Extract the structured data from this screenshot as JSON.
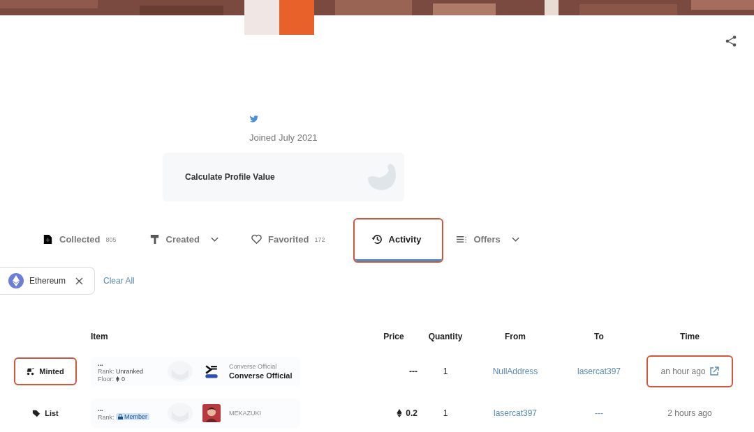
{
  "profile": {
    "joined": "Joined July 2021",
    "calculate_card": "Calculate Profile Value"
  },
  "tabs": [
    {
      "kind": "collected",
      "label": "Collected",
      "count": "805",
      "dropdown": false,
      "selected": false,
      "annotated": false
    },
    {
      "kind": "created",
      "label": "Created",
      "dropdown": true,
      "selected": false,
      "annotated": false
    },
    {
      "kind": "favorited",
      "label": "Favorited",
      "count": "172",
      "dropdown": false,
      "selected": false,
      "annotated": false
    },
    {
      "kind": "activity",
      "label": "Activity",
      "dropdown": false,
      "selected": true,
      "annotated": true
    },
    {
      "kind": "offers",
      "label": "Offers",
      "dropdown": true,
      "selected": false,
      "annotated": false
    }
  ],
  "filters": {
    "chips": [
      {
        "label": "Ethereum"
      }
    ],
    "clear": "Clear All"
  },
  "table": {
    "columns": [
      "Item",
      "Price",
      "Quantity",
      "From",
      "To",
      "Time"
    ],
    "rows": [
      {
        "event": {
          "kind": "mint",
          "label": "Minted",
          "annotated": true
        },
        "item_top": "...",
        "rank": {
          "kind": "text",
          "label": "Rank:",
          "value": "Unranked"
        },
        "floor_label": "Floor:",
        "floor": "0",
        "collection": "Converse Official",
        "name": "Converse Official",
        "thumb": {
          "kind": "converse"
        },
        "price": "---",
        "price_eth": false,
        "quantity": "1",
        "from": "NullAddress",
        "to": "lasercat397",
        "time": "an hour ago",
        "time_link": true,
        "time_annotated": true
      },
      {
        "event": {
          "kind": "list",
          "label": "List",
          "annotated": false
        },
        "item_top": "...",
        "rank": {
          "kind": "badge",
          "label": "Rank:",
          "value": "Member"
        },
        "collection": "MEKAZUKI",
        "thumb": {
          "kind": "portrait"
        },
        "price": "0.2",
        "price_eth": true,
        "quantity": "1",
        "from": "lasercat397",
        "to": "---",
        "time": "2 hours ago",
        "time_link": false,
        "time_annotated": false
      }
    ]
  }
}
